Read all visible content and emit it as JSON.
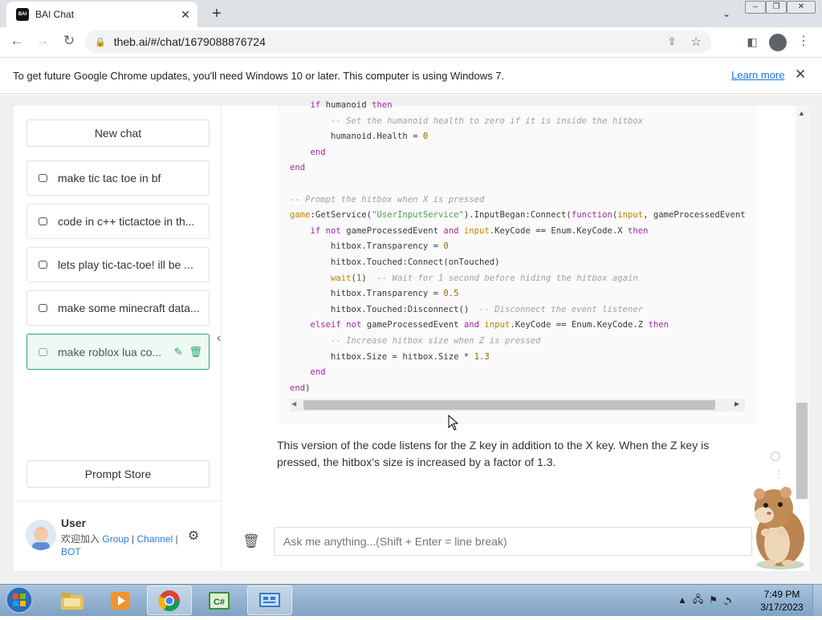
{
  "browser": {
    "tab_title": "BAI Chat",
    "favicon_text": "BAI",
    "url": "theb.ai/#/chat/1679088876724",
    "infobar_message": "To get future Google Chrome updates, you'll need Windows 10 or later. This computer is using Windows 7.",
    "learn_more": "Learn more"
  },
  "sidebar": {
    "new_chat": "New chat",
    "chats": [
      {
        "title": "make tic tac toe in bf"
      },
      {
        "title": "code in c++ tictactoe in th..."
      },
      {
        "title": "lets play tic-tac-toe! ill be ..."
      },
      {
        "title": "make some minecraft data..."
      },
      {
        "title": "make roblox lua co...",
        "active": true
      }
    ],
    "prompt_store": "Prompt Store",
    "user": {
      "name": "User",
      "welcome": "欢迎加入",
      "links": [
        "Group",
        "Channel",
        "BOT"
      ]
    }
  },
  "conversation": {
    "code_lines": [
      "    if humanoid then",
      "        -- Set the humanoid health to zero if it is inside the hitbox",
      "        humanoid.Health = 0",
      "    end",
      "end",
      "",
      "-- Prompt the hitbox when X is pressed",
      "game:GetService(\"UserInputService\").InputBegan:Connect(function(input, gameProcessedEvent",
      "    if not gameProcessedEvent and input.KeyCode == Enum.KeyCode.X then",
      "        hitbox.Transparency = 0",
      "        hitbox.Touched:Connect(onTouched)",
      "        wait(1)  -- Wait for 1 second before hiding the hitbox again",
      "        hitbox.Transparency = 0.5",
      "        hitbox.Touched:Disconnect()  -- Disconnect the event listener",
      "    elseif not gameProcessedEvent and input.KeyCode == Enum.KeyCode.Z then",
      "        -- Increase hitbox size when Z is pressed",
      "        hitbox.Size = hitbox.Size * 1.3",
      "    end",
      "end)"
    ],
    "answer": "This version of the code listens for the Z key in addition to the X key. When the Z key is pressed, the hitbox's size is increased by a factor of 1.3.",
    "input_placeholder": "Ask me anything...(Shift + Enter = line break)"
  },
  "taskbar": {
    "time": "7:49 PM",
    "date": "3/17/2023",
    "apps": [
      "windows-explorer",
      "media-player",
      "chrome",
      "csharp-editor",
      "remote-desktop"
    ]
  },
  "colors": {
    "accent": "#29a870",
    "link": "#1a73e8",
    "keyword": "#a626a4",
    "string": "#50a14f",
    "comment": "#a0a1a7"
  }
}
